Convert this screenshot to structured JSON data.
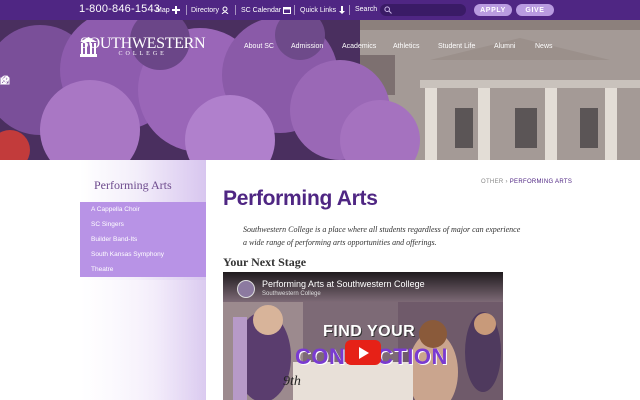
{
  "topbar": {
    "phone": "1-800-846-1543",
    "map_label": "Map",
    "directory_label": "Directory",
    "calendar_label": "SC Calendar",
    "quick_links_label": "Quick Links",
    "search_label": "Search",
    "search_placeholder": "",
    "apply_label": "APPLY",
    "give_label": "GIVE",
    "icons": [
      "plus-icon",
      "directory-icon",
      "calendar-icon",
      "arrow-down-icon",
      "search-icon"
    ]
  },
  "header": {
    "logo_name": "SOUTHWESTERN",
    "logo_sub": "COLLEGE",
    "nav": [
      "About SC",
      "Admission",
      "Academics",
      "Athletics",
      "Student Life",
      "Alumni",
      "News"
    ],
    "side_tools": [
      "pencil-icon",
      "location-pin-icon",
      "gift-icon"
    ]
  },
  "sidebar": {
    "title": "Performing Arts",
    "items": [
      "A Cappella Choir",
      "SC Singers",
      "Builder Band-Its",
      "South Kansas Symphony",
      "Theatre"
    ]
  },
  "main": {
    "breadcrumb_parent": "OTHER",
    "breadcrumb_sep": "›",
    "breadcrumb_current": "PERFORMING ARTS",
    "title": "Performing Arts",
    "intro": "Southwestern College is a place where all students regardless of major can experience a wide range of performing arts opportunities and offerings.",
    "section_heading": "Your Next Stage"
  },
  "video": {
    "title": "Performing Arts at Southwestern College",
    "channel": "Southwestern College",
    "overlay_line1": "FIND YOUR",
    "overlay_line2": "CONNECTION",
    "shirt_text": "9th"
  },
  "colors": {
    "brand_purple": "#4f2683",
    "sidebar_menu": "#b893e6",
    "pill": "#b99be0",
    "play_red": "#e62117"
  }
}
